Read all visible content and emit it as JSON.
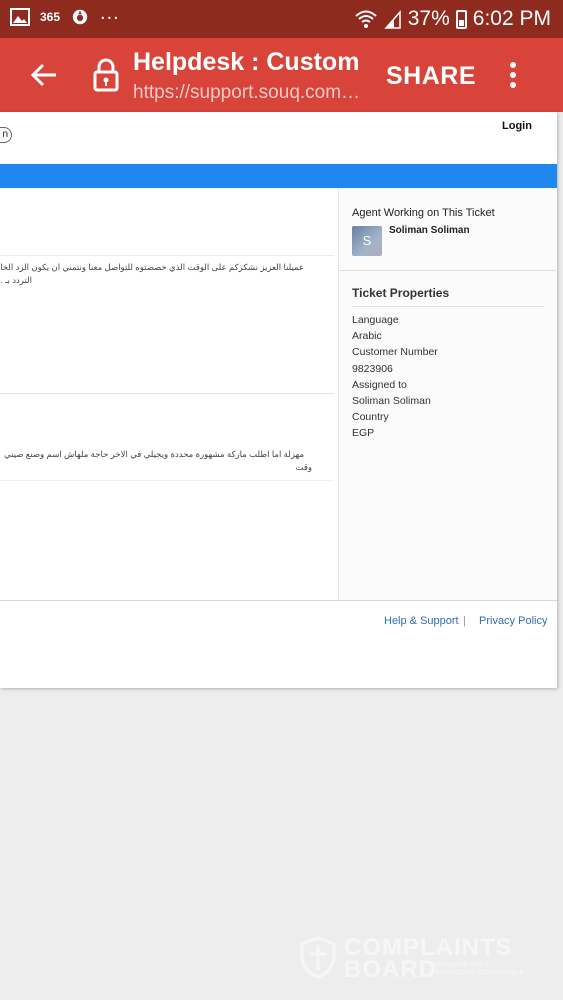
{
  "status_bar": {
    "carrier_badge": "365",
    "overflow": "...",
    "battery": "37%",
    "time": "6:02 PM",
    "icons": [
      "gallery-icon",
      "news-365-icon",
      "app-icon",
      "wifi-icon",
      "signal-icon",
      "battery-icon"
    ]
  },
  "toolbar": {
    "title": "Helpdesk : Custom…",
    "url": "https://support.souq.com…",
    "share_label": "SHARE",
    "color": "#d9443a"
  },
  "site": {
    "pill_text": "n",
    "login_label": "Login",
    "accent_bar_color": "#1e88f0"
  },
  "messages": [
    {
      "lines": [
        "عميلنا العزيز نشكركم على الوقت الذي خصصتوه للتواصل معنا ونتمني ان يكون الرد الخاص",
        "التردد بـ .."
      ]
    },
    {
      "lines": [
        "مهزلة اما اطلب ماركة مشهورة محددة ويجيلي في الاخر حاجة ملهاش اسم وصنع صيني",
        "وقت"
      ]
    }
  ],
  "sidebar": {
    "agent_heading": "Agent Working on This Ticket",
    "avatar_initial": "S",
    "agent_name": "Soliman Soliman",
    "props_heading": "Ticket Properties",
    "props": [
      "Language",
      "Arabic",
      "Customer Number",
      "9823906",
      "Assigned to",
      "Soliman Soliman",
      "Country",
      "EGP"
    ]
  },
  "footer": {
    "help_link": "Help & Support",
    "separator": "|",
    "privacy_link": "Privacy Policy"
  },
  "watermark": {
    "line1": "COMPLAINTS",
    "line2": "BOARD",
    "sub": "RESOLVE WITH CUSTOMER CONFIDENCE"
  }
}
